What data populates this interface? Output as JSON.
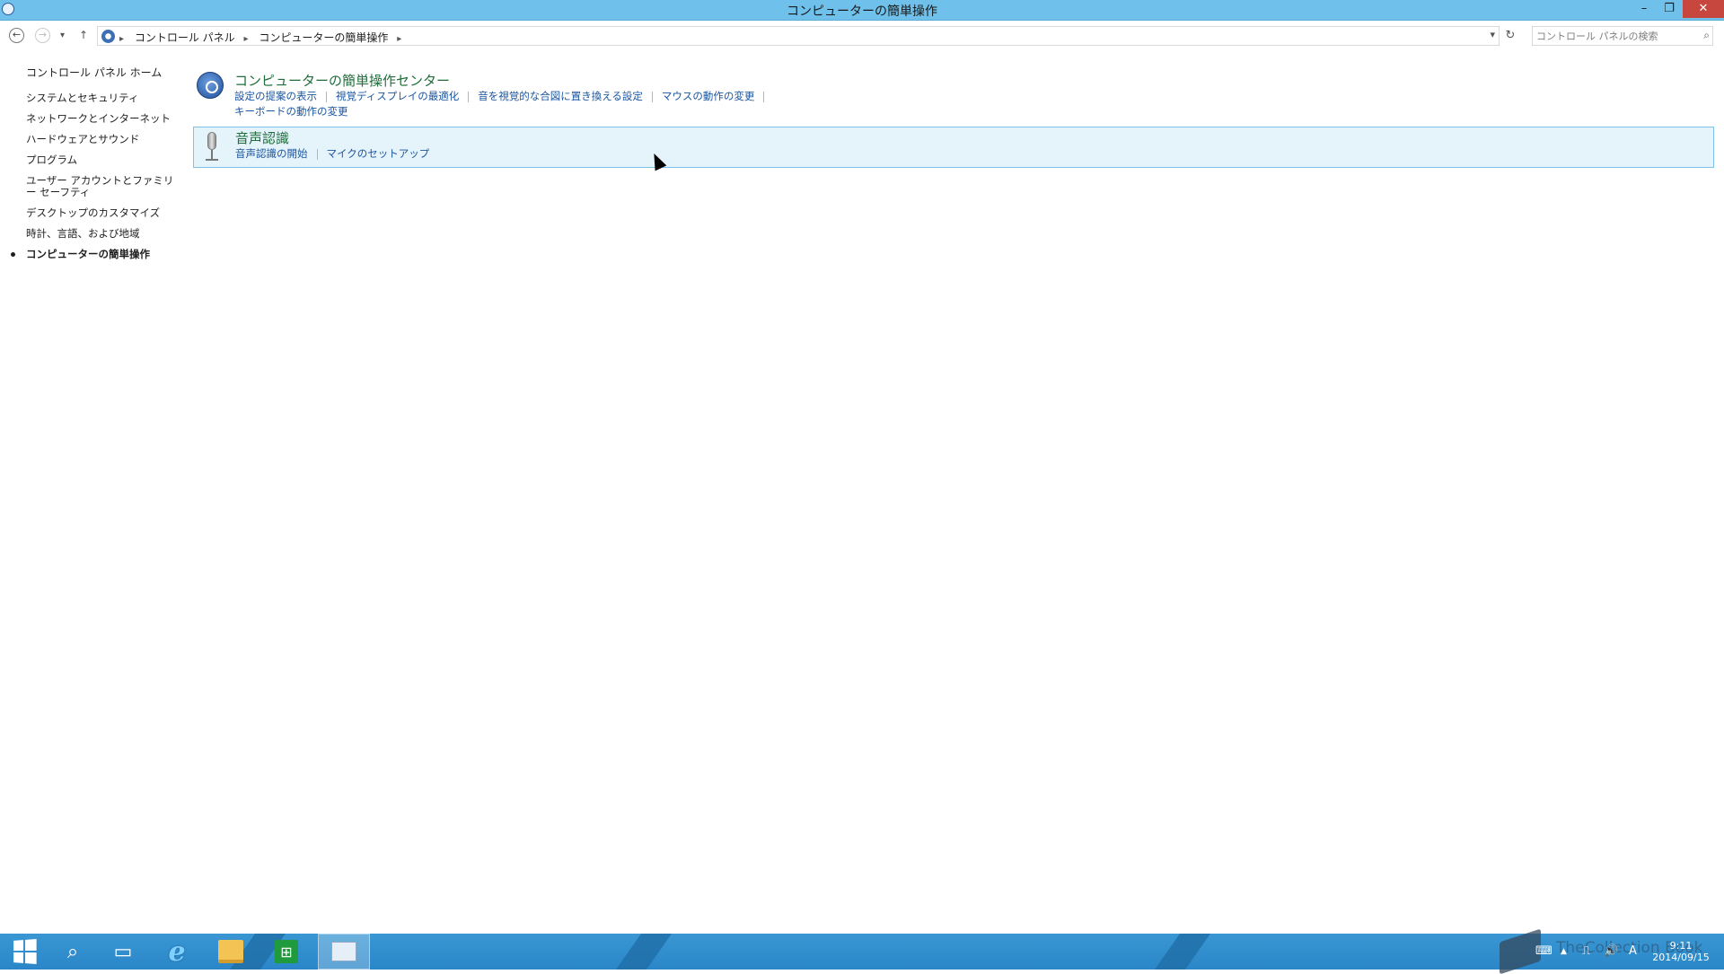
{
  "window": {
    "title": "コンピューターの簡単操作",
    "controls": {
      "minimize": "–",
      "restore": "❐",
      "close": "✕"
    }
  },
  "address_bar": {
    "back": "←",
    "forward": "→",
    "recent": "▾",
    "up": "↑",
    "breadcrumbs": [
      "コントロール パネル",
      "コンピューターの簡単操作"
    ],
    "separator": "▸",
    "dropdown": "▾",
    "refresh": "↻",
    "search_placeholder": "コントロール パネルの検索",
    "search_glyph": "⌕"
  },
  "left_nav": {
    "home": "コントロール パネル ホーム",
    "items": [
      "システムとセキュリティ",
      "ネットワークとインターネット",
      "ハードウェアとサウンド",
      "プログラム",
      "ユーザー アカウントとファミリー セーフティ",
      "デスクトップのカスタマイズ",
      "時計、言語、および地域",
      "コンピューターの簡単操作"
    ]
  },
  "sections": [
    {
      "title": "コンピューターの簡単操作センター",
      "icon": "ease-of-access-icon",
      "links_row1": [
        "設定の提案の表示",
        "視覚ディスプレイの最適化",
        "音を視覚的な合図に置き換える設定",
        "マウスの動作の変更"
      ],
      "links_row2": [
        "キーボードの動作の変更"
      ]
    },
    {
      "title": "音声認識",
      "icon": "microphone-icon",
      "links_row1": [
        "音声認識の開始",
        "マイクのセットアップ"
      ]
    }
  ],
  "taskbar": {
    "search_glyph": "⌕",
    "files_glyph": "▭",
    "ie_glyph": "e",
    "store_glyph": "⊞",
    "tray_icons": [
      "⌨",
      "▲",
      "⎍",
      "🔊",
      "A"
    ],
    "time": "9:11",
    "date": "2014/09/15",
    "watermark": "TheCollection Book"
  },
  "colors": {
    "titlebar": "#6fc0ea",
    "link": "#1c56a0",
    "section_title": "#1e6d3a",
    "highlight_bg": "#e5f3fb",
    "highlight_border": "#7fc4e8",
    "taskbar": "#2a86c8",
    "close_button": "#c7463d"
  }
}
